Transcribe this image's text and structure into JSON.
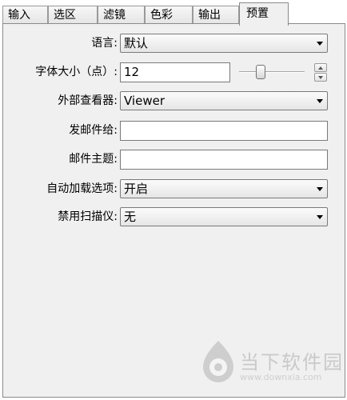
{
  "tabs": [
    "输入",
    "选区",
    "滤镜",
    "色彩",
    "输出",
    "预置"
  ],
  "active_tab": "预置",
  "form": {
    "language": {
      "label": "语言:",
      "value": "默认"
    },
    "font_size": {
      "label": "字体大小（点）:",
      "value": "12",
      "slider_level": 0.3
    },
    "external_viewer": {
      "label": "外部查看器:",
      "value": "Viewer"
    },
    "send_mail_to": {
      "label": "发邮件给:",
      "value": ""
    },
    "mail_subject": {
      "label": "邮件主题:",
      "value": ""
    },
    "autoload_options": {
      "label": "自动加载选项:",
      "value": "开启"
    },
    "disable_scanner": {
      "label": "禁用扫描仪:",
      "value": "无"
    }
  },
  "watermark": {
    "title": "当下软件园",
    "url": "www.downxia.com"
  },
  "icons": [
    "chevron-down-icon",
    "spin-up-icon",
    "spin-down-icon",
    "slider-thumb-icon"
  ]
}
